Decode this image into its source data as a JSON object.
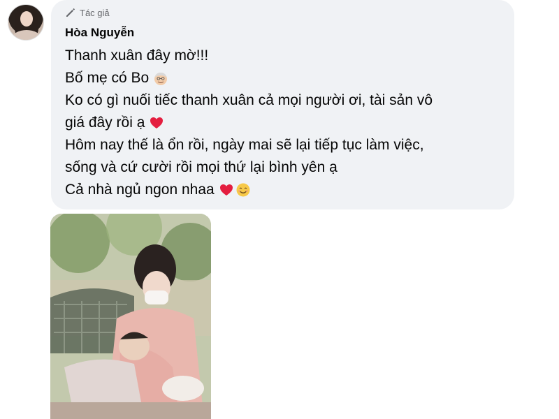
{
  "comment": {
    "author_badge": "Tác giả",
    "author_name": "Hòa Nguyễn",
    "lines": [
      "Thanh xuân đây mờ!!!",
      "Bố mẹ có Bo",
      "Ko có gì nuối tiếc thanh xuân cả mọi người ơi, tài sản vô",
      "giá đây rồi ạ",
      "Hôm nay thế là ổn rồi, ngày mai sẽ lại tiếp tục làm việc,",
      "sống và cứ cười rồi mọi thứ lại bình yên ạ",
      "Cả nhà ngủ ngon nhaa"
    ]
  },
  "icons": {
    "author_badge": "pencil-icon",
    "line2_emoji": "old-man-emoji-icon",
    "line4_emoji": "red-heart-icon",
    "line7_emoji_1": "red-heart-icon",
    "line7_emoji_2": "smiling-face-icon"
  },
  "colors": {
    "bubble_background": "#f0f2f5",
    "secondary_text": "#65676b",
    "heart": "#e41e3f"
  },
  "attachment": {
    "type": "photo"
  }
}
